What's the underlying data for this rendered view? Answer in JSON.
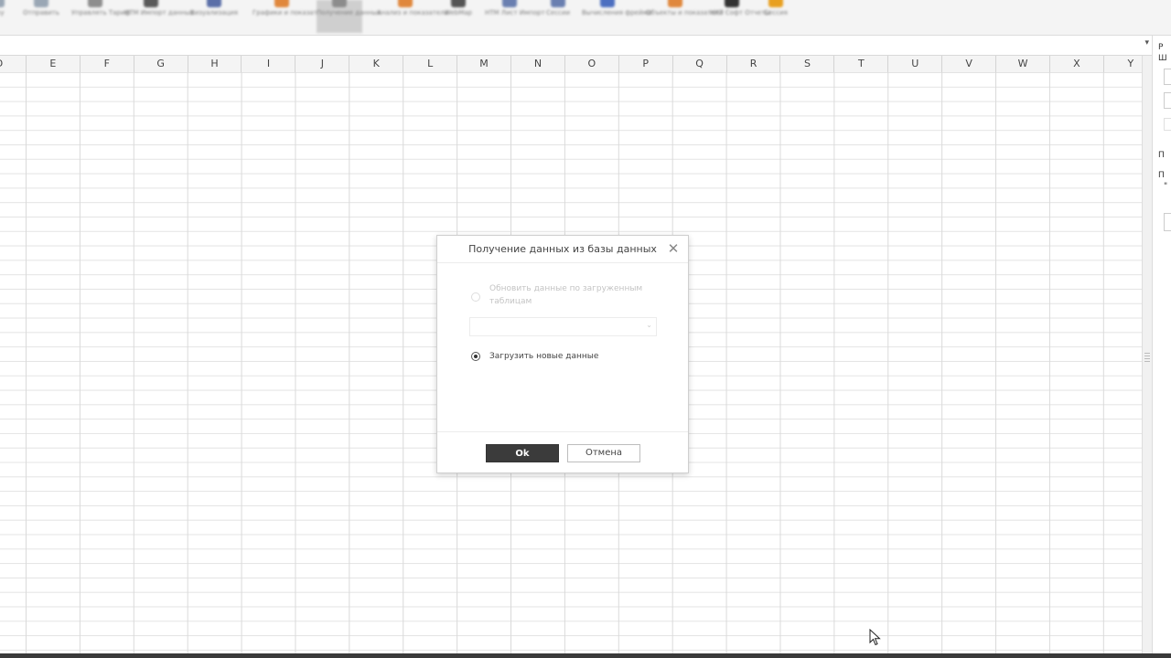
{
  "ribbon": {
    "buttons": [
      {
        "label": "…ку",
        "color": "#9aa7b5"
      },
      {
        "label": "Отправить",
        "color": "#9aa7b5"
      },
      {
        "label": "Управлять Тариф",
        "color": "#8e8e8e"
      },
      {
        "label": "НТМ Импорт данных",
        "color": "#5a5a5a"
      },
      {
        "label": "Визуализация",
        "color": "#5b6fa8"
      },
      {
        "label": "Графики и показатели",
        "color": "#e0873c"
      },
      {
        "label": "Получение данных",
        "color": "#8c8c8c",
        "active": true
      },
      {
        "label": "Анализ и показатели",
        "color": "#e0873c"
      },
      {
        "label": "WebMap",
        "color": "#555555"
      },
      {
        "label": "НТМ Лист Импорт",
        "color": "#6a7fb0"
      },
      {
        "label": "Сессии",
        "color": "#6a7fb0"
      },
      {
        "label": "Вычисления фрейма",
        "color": "#4d6fc0"
      },
      {
        "label": "Объекты и показатели",
        "color": "#e0873c"
      },
      {
        "label": "НКТ Софт Отчеты",
        "color": "#333333"
      },
      {
        "label": "Сессия",
        "color": "#e8a020"
      }
    ]
  },
  "columns": [
    "D",
    "E",
    "F",
    "G",
    "H",
    "I",
    "J",
    "K",
    "L",
    "M",
    "N",
    "O",
    "P",
    "Q",
    "R",
    "S",
    "T",
    "U",
    "V",
    "W",
    "X",
    "Y"
  ],
  "right_panel": {
    "line1": "Р",
    "line2": "Ш",
    "line3": "П",
    "line4": "П",
    "line5": "\""
  },
  "dialog": {
    "title": "Получение данных из базы данных",
    "close_glyph": "✕",
    "option_update": "Обновить данные по загруженным таблицам",
    "option_new": "Загрузить новые данные",
    "select_value": "",
    "ok_label": "Ok",
    "cancel_label": "Отмена"
  }
}
